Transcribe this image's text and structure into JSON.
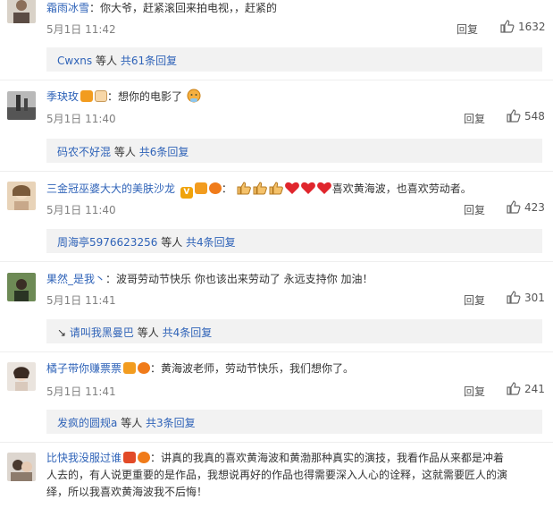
{
  "reply_label": "回复",
  "sub_suffix": "等人",
  "comments": [
    {
      "user": "霜雨冰雪",
      "text": "：你大爷，赶紧滚回来拍电视，，赶紧的",
      "time": "5月1日 11:42",
      "likes": "1632",
      "sub_user": "Cwxns",
      "sub_count": "共61条回复"
    },
    {
      "user": "季玦玫",
      "text": "：想你的电影了",
      "time": "5月1日 11:40",
      "likes": "548",
      "sub_user": "码农不好混",
      "sub_count": "共6条回复"
    },
    {
      "user": "三金冠巫婆大大的美肤沙龙",
      "text": "喜欢黄海波，也喜欢劳动者。",
      "time": "5月1日 11:40",
      "likes": "423",
      "sub_user": "周海亭5976623256",
      "sub_count": "共4条回复"
    },
    {
      "user": "果然_是我丶",
      "text": "：波哥劳动节快乐 你也该出来劳动了 永远支持你 加油！",
      "time": "5月1日 11:41",
      "likes": "301",
      "sub_user": "请叫我黑曼巴",
      "sub_count": "共4条回复"
    },
    {
      "user": "橘子带你赚票票",
      "text": "：黄海波老师，劳动节快乐，我们想你了。",
      "time": "5月1日 11:41",
      "likes": "241",
      "sub_user": "发疯的圆规a",
      "sub_count": "共3条回复"
    },
    {
      "user": "比快我没服过谁",
      "text_l1": "：讲真的我真的喜欢黄海波和黄渤那种真实的演技，我看作品从来都是冲着",
      "text_l2": "人去的，有人说更重要的是作品，我想说再好的作品也得需要深入人心的诠释，这就需要匠人的演",
      "text_l3": "绎，所以我喜欢黄海波我不后悔！"
    }
  ],
  "colors": {
    "link": "#2f63b8",
    "subbox_bg": "#f2f2f2",
    "muted": "#808080"
  }
}
